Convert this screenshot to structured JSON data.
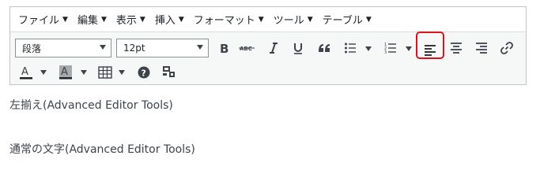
{
  "menubar": {
    "items": [
      {
        "label": "ファイル"
      },
      {
        "label": "編集"
      },
      {
        "label": "表示"
      },
      {
        "label": "挿入"
      },
      {
        "label": "フォーマット"
      },
      {
        "label": "ツール"
      },
      {
        "label": "テーブル"
      }
    ]
  },
  "toolbar": {
    "format_select": "段落",
    "size_select": "12pt",
    "icons": [
      "bold-icon",
      "strikethrough-icon",
      "italic-icon",
      "underline-icon",
      "blockquote-icon",
      "bullet-list-icon",
      "numbered-list-icon",
      "align-left-icon",
      "align-center-icon",
      "align-right-icon",
      "link-icon",
      "text-color-icon",
      "background-color-icon",
      "table-icon",
      "help-icon",
      "code-icon"
    ],
    "active_button": "align-left-icon"
  },
  "content": {
    "line1": "左揃え(Advanced Editor Tools)",
    "line2": "通常の文字(Advanced Editor Tools)"
  },
  "colors": {
    "highlight": "#e0101a",
    "border": "#c3c4c7",
    "icon": "#3c434a"
  }
}
